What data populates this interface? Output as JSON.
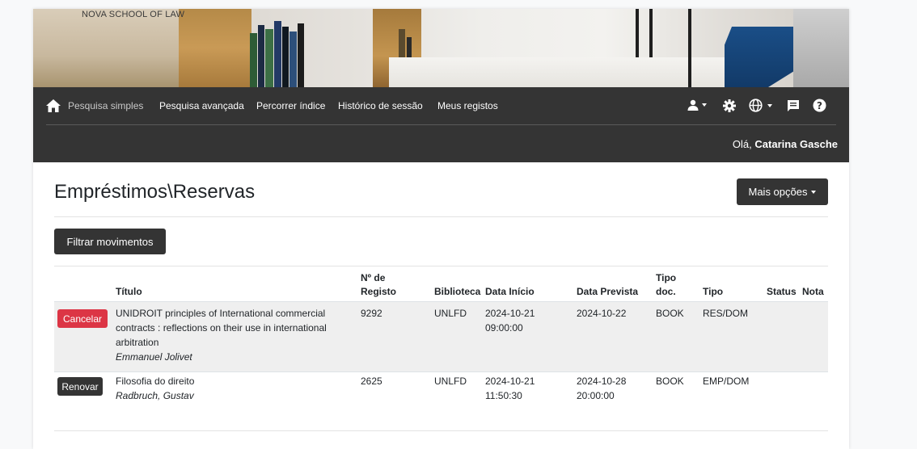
{
  "brand": {
    "text": "NOVA SCHOOL OF LAW"
  },
  "nav": {
    "items": [
      {
        "label": "Pesquisa simples"
      },
      {
        "label": "Pesquisa avançada"
      },
      {
        "label": "Percorrer índice"
      },
      {
        "label": "Histórico de sessão"
      },
      {
        "label": "Meus registos"
      }
    ],
    "icons": [
      "home-icon",
      "user-icon",
      "gear-icon",
      "globe-icon",
      "message-icon",
      "help-icon"
    ]
  },
  "greeting": {
    "prefix": "Olá, ",
    "name": "Catarina Gasche"
  },
  "page": {
    "title": "Empréstimos\\Reservas",
    "more_label": "Mais opções",
    "filter_label": "Filtrar movimentos"
  },
  "table": {
    "headers": {
      "titulo": "Título",
      "registo_line1": "Nº de",
      "registo_line2": "Registo",
      "biblioteca": "Biblioteca",
      "data_inicio": "Data Início",
      "data_prevista": "Data Prevista",
      "tipo_doc_line1": "Tipo",
      "tipo_doc_line2": "doc.",
      "tipo": "Tipo",
      "status": "Status",
      "nota": "Nota"
    },
    "rows": [
      {
        "action": "Cancelar",
        "title_line1": "UNIDROIT principles of International commercial",
        "title_line2": "contracts : reflections on their use in international",
        "title_line3": "arbitration",
        "author": "Emmanuel Jolivet",
        "registo": "9292",
        "biblioteca": "UNLFD",
        "inicio_date": "2024-10-21",
        "inicio_time": "09:00:00",
        "prevista_date": "2024-10-22",
        "prevista_time": "",
        "tipo_doc": "BOOK",
        "tipo": "RES/DOM",
        "status": "",
        "nota": ""
      },
      {
        "action": "Renovar",
        "title_line1": "Filosofia do direito",
        "author": "Radbruch, Gustav",
        "registo": "2625",
        "biblioteca": "UNLFD",
        "inicio_date": "2024-10-21",
        "inicio_time": "11:50:30",
        "prevista_date": "2024-10-28",
        "prevista_time": "20:00:00",
        "tipo_doc": "BOOK",
        "tipo": "EMP/DOM",
        "status": "",
        "nota": ""
      }
    ]
  },
  "colors": {
    "navbar": "#343434",
    "cancel": "#dc3545",
    "dark_button": "#343434",
    "row_highlight": "#efefef"
  }
}
